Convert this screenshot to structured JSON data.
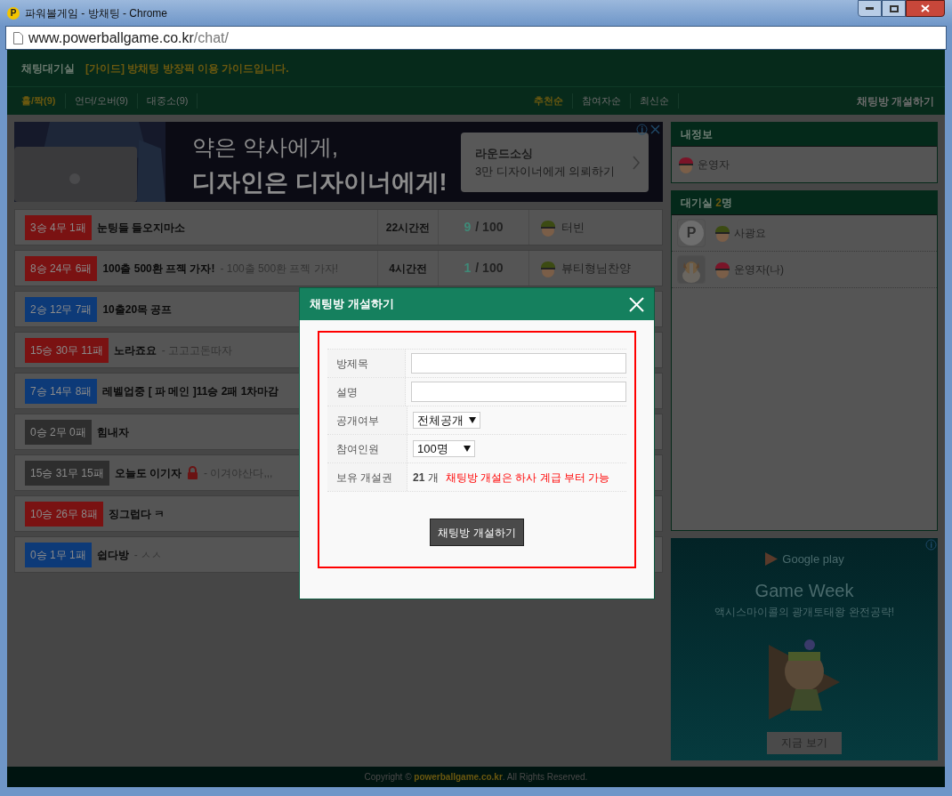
{
  "window": {
    "title": "파워볼게임 - 방채팅 - Chrome",
    "favicon": "P"
  },
  "address_bar": {
    "host": "www.powerballgame.co.kr",
    "path": "/chat/"
  },
  "header": {
    "title": "채팅대기실",
    "notice": "[가이드] 방채팅 방장픽 이용 가이드입니다."
  },
  "filters": [
    {
      "label": "홀/짝(9)",
      "selected": true
    },
    {
      "label": "언더/오버(9)",
      "selected": false
    },
    {
      "label": "대중소(9)",
      "selected": false
    }
  ],
  "sorts": [
    {
      "label": "추천순",
      "selected": true
    },
    {
      "label": "참여자순",
      "selected": false
    },
    {
      "label": "최신순",
      "selected": false
    }
  ],
  "create_link": "채팅방 개설하기",
  "banner_ad": {
    "headline_1": "약은 약사에게,",
    "headline_2": "디자인은 디자이너에게!",
    "card_title": "라운드소싱",
    "card_text": "3만 디자이너에게 의뢰하기"
  },
  "rooms": [
    {
      "record": "3승 4무 1패",
      "color": "#7a1212",
      "title": "눈팅들 들오지마소",
      "locked": false,
      "time": "22시간전",
      "members": "9",
      "capacity": "/ 100",
      "owner": {
        "name": "터빈",
        "color": "#3c4b13"
      }
    },
    {
      "record": "8승 24무 6패",
      "color": "#7a1212",
      "title": "100출 500환 프젝 가자!",
      "subtitle": "- 100출 500환 프젝 가자!",
      "locked": false,
      "time": "4시간전",
      "members": "1",
      "capacity": "/ 100",
      "owner": {
        "name": "뷰티형님찬양",
        "color": "#3c4b13"
      }
    },
    {
      "record": "2승 12무 7패",
      "color": "#0d3a78",
      "title": "10출20목 공프",
      "locked": false
    },
    {
      "record": "15승 30무 11패",
      "color": "#7a1212",
      "title": "노라죠요",
      "subtitle": "- 고고고돈따자",
      "locked": false
    },
    {
      "record": "7승 14무 8패",
      "color": "#0d3a78",
      "title": "레벨업중 [ 파 메인 ]11승 2패 1차마감",
      "locked": false
    },
    {
      "record": "0승 2무 0패",
      "color": "#2e2e2e",
      "title": "힘내자",
      "locked": false
    },
    {
      "record": "15승 31무 15패",
      "color": "#2e2e2e",
      "title": "오늘도 이기자",
      "subtitle": "- 이겨야산다,,,",
      "locked": true
    },
    {
      "record": "10승 26무 8패",
      "color": "#7a1212",
      "title": "징그럽다 ㅋ",
      "locked": false
    },
    {
      "record": "0승 1무 1패",
      "color": "#0d3a78",
      "title": "쉽다방",
      "subtitle": "- ㅅㅅ",
      "locked": false
    }
  ],
  "my_info": {
    "title": "내정보",
    "user": {
      "name": "운영자",
      "color": "#7a1428"
    }
  },
  "lobby": {
    "title": "대기실",
    "count": "2",
    "unit": "명",
    "users": [
      {
        "avatar": {
          "kind": "logo",
          "text": "P"
        },
        "name": "사광요",
        "color": "#3c4b13"
      },
      {
        "name": "운영자(나)",
        "color": "#7a1428"
      }
    ]
  },
  "side_ad": {
    "brand": "Google play",
    "title": "Game Week",
    "text": "액시스마이콜의 광개토태왕 완전공략!",
    "button": "지금 보기"
  },
  "footer": "Copyright © **powerballgame.co.kr**. All Rights Reserved.",
  "modal": {
    "title": "채팅방 개설하기",
    "fields": [
      {
        "kind": "text",
        "label": "방제목"
      },
      {
        "kind": "text",
        "label": "설명"
      },
      {
        "kind": "select",
        "label": "공개여부",
        "value": "전체공개"
      },
      {
        "kind": "select",
        "label": "참여인원",
        "value": "100명"
      },
      {
        "kind": "tickets",
        "label": "보유 개설권",
        "count": "21",
        "unit": "개",
        "notice": "채팅방 개설은 하사 계급 부터 가능"
      }
    ],
    "submit": "채팅방 개설하기"
  }
}
